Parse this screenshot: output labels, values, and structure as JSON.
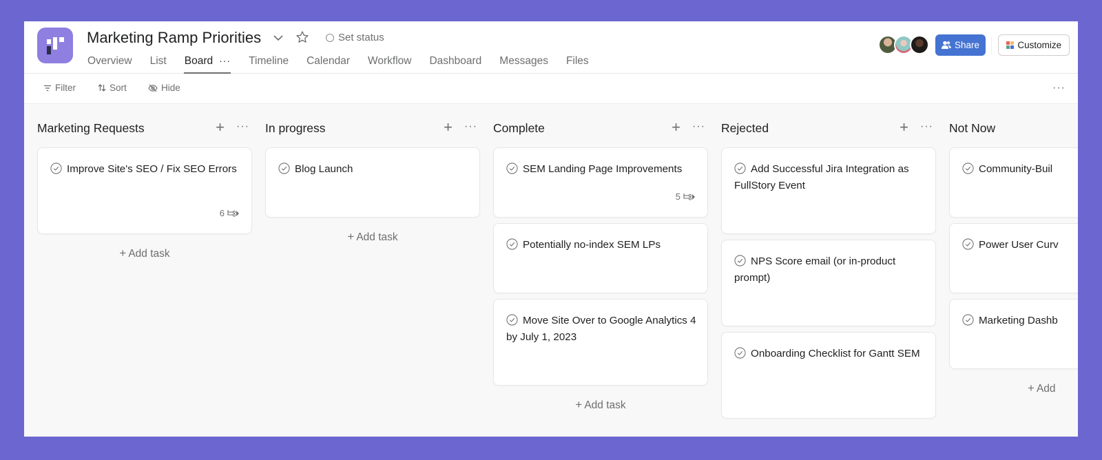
{
  "project": {
    "title": "Marketing Ramp Priorities",
    "set_status_label": "Set status",
    "logo_color": "#8f7fe0"
  },
  "tabs": [
    {
      "label": "Overview",
      "active": false
    },
    {
      "label": "List",
      "active": false
    },
    {
      "label": "Board",
      "active": true,
      "has_menu": true,
      "menu_glyph": "···"
    },
    {
      "label": "Timeline",
      "active": false
    },
    {
      "label": "Calendar",
      "active": false
    },
    {
      "label": "Workflow",
      "active": false
    },
    {
      "label": "Dashboard",
      "active": false
    },
    {
      "label": "Messages",
      "active": false
    },
    {
      "label": "Files",
      "active": false
    }
  ],
  "header_actions": {
    "share_label": "Share",
    "customize_label": "Customize",
    "share_color": "#4573d2",
    "member_avatars": 3
  },
  "toolbar": {
    "filter_label": "Filter",
    "sort_label": "Sort",
    "hide_label": "Hide",
    "more_glyph": "···"
  },
  "board": {
    "add_task_label": "Add task",
    "columns": [
      {
        "title": "Marketing Requests",
        "tasks": [
          {
            "title": "Improve Site's SEO / Fix SEO Errors",
            "subtask_count": "6"
          }
        ]
      },
      {
        "title": "In progress",
        "tasks": [
          {
            "title": "Blog Launch"
          }
        ]
      },
      {
        "title": "Complete",
        "tasks": [
          {
            "title": "SEM Landing Page Improvements",
            "subtask_count": "5"
          },
          {
            "title": "Potentially no-index SEM LPs"
          },
          {
            "title": "Move Site Over to Google Analytics 4 by July 1, 2023"
          }
        ]
      },
      {
        "title": "Rejected",
        "tasks": [
          {
            "title": "Add Successful Jira Integration as FullStory Event"
          },
          {
            "title": "NPS Score email (or in-product prompt)"
          },
          {
            "title": "Onboarding Checklist for Gantt SEM"
          }
        ]
      },
      {
        "title": "Not Now",
        "tasks": [
          {
            "title": "Community-Buil"
          },
          {
            "title": "Power User Curv"
          },
          {
            "title": "Marketing Dashb"
          }
        ],
        "add_task_label_visible": "Add"
      }
    ]
  }
}
